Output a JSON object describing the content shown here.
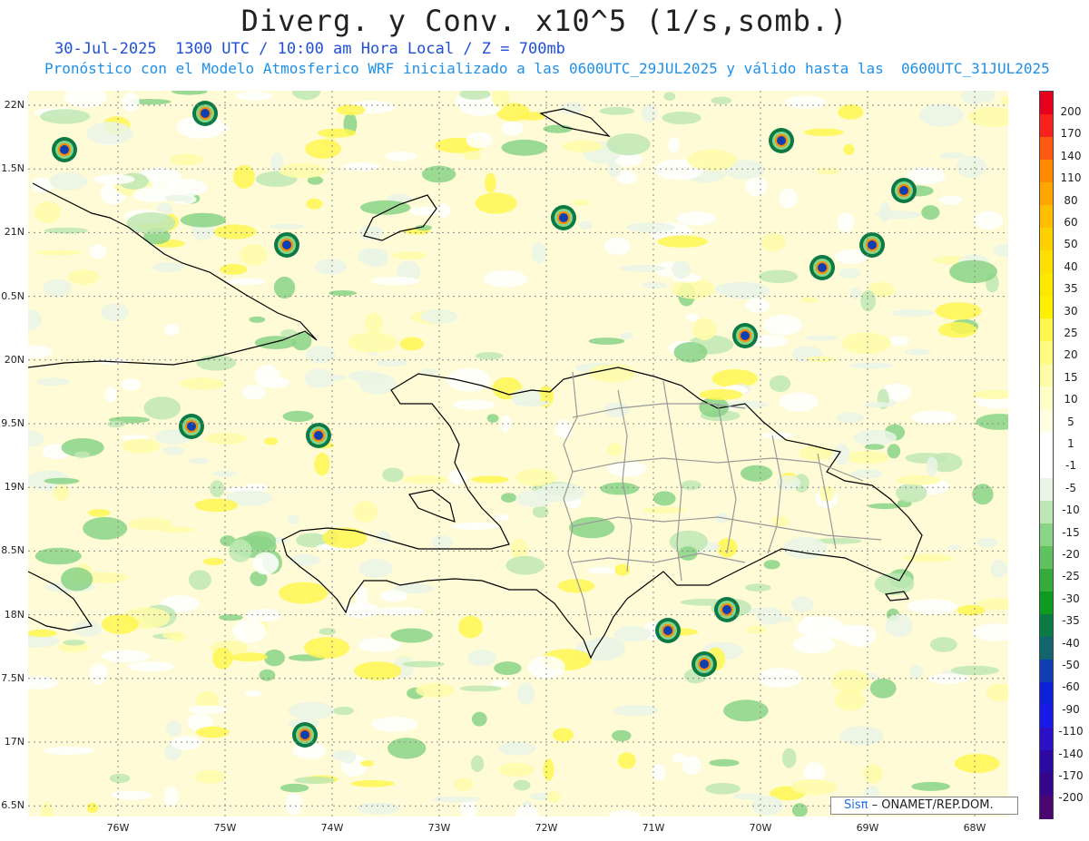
{
  "header": {
    "title": "Diverg. y Conv. x10^5 (1/s,somb.)",
    "subtitle1": "30-Jul-2025  1300 UTC / 10:00 am Hora Local / Z = 700mb",
    "subtitle2": "Pronóstico con el Modelo Atmosferico WRF inicializado a las 0600UTC_29JUL2025 y válido hasta las  0600UTC_31JUL2025"
  },
  "map": {
    "lat_labels": [
      "22N",
      "1.5N",
      "21N",
      "0.5N",
      "20N",
      "9.5N",
      "19N",
      "8.5N",
      "18N",
      "7.5N",
      "17N",
      "6.5N"
    ],
    "lon_labels": [
      "76W",
      "75W",
      "74W",
      "73W",
      "72W",
      "71W",
      "70W",
      "69W",
      "68W"
    ],
    "grid": true,
    "region": "Hispaniola"
  },
  "colorbar": {
    "labels": [
      "200",
      "170",
      "140",
      "110",
      "80",
      "60",
      "50",
      "40",
      "35",
      "30",
      "25",
      "20",
      "15",
      "10",
      "5",
      "1",
      "-1",
      "-5",
      "-10",
      "-15",
      "-20",
      "-25",
      "-30",
      "-35",
      "-40",
      "-50",
      "-60",
      "-90",
      "-110",
      "-140",
      "-170",
      "-200"
    ],
    "colors": [
      "#e4001e",
      "#f6221c",
      "#fb5a10",
      "#ff8a00",
      "#ffa700",
      "#ffbf00",
      "#ffd000",
      "#ffde00",
      "#ffe800",
      "#fff000",
      "#fff650",
      "#fffb80",
      "#fffca8",
      "#fffdc8",
      "#fffee0",
      "#ffffff",
      "#ffffff",
      "#eaf5e6",
      "#bfe7b5",
      "#8ad487",
      "#5fc25f",
      "#34ab3a",
      "#0f9a20",
      "#0b7a45",
      "#11666e",
      "#0f3fb0",
      "#0d22d8",
      "#1a1ae6",
      "#2a12c4",
      "#2c0aa2",
      "#34078a",
      "#4a0772"
    ]
  },
  "credit": {
    "brand": "Sisπ",
    "text": "– ONAMET/REP.DOM."
  }
}
